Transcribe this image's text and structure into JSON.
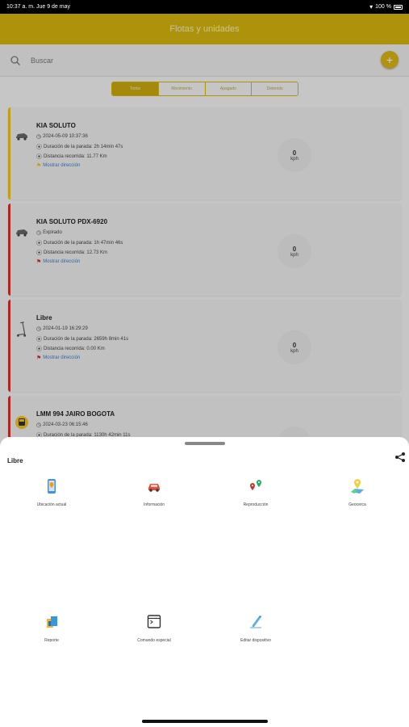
{
  "status_bar": {
    "time_date": "10:37 a. m.  Jue 9 de may",
    "battery": "100 %"
  },
  "header": {
    "title": "Flotas y unidades"
  },
  "search": {
    "placeholder": "Buscar",
    "add_label": "+"
  },
  "tabs": [
    {
      "label": "Todos",
      "active": true
    },
    {
      "label": "Movimiento",
      "active": false
    },
    {
      "label": "Apagado",
      "active": false
    },
    {
      "label": "Detenido",
      "active": false
    }
  ],
  "cards": [
    {
      "name": "KIA SOLUTO",
      "status_color": "#e8c31a",
      "vehicle_icon": "car-icon",
      "line1": "2024-05-09 10:37:36",
      "line2": "Duración de la parada: 2h 14min 47s",
      "line3": "Distancia recorrida: 11.77 Km",
      "link": "Mostrar dirección",
      "speed": "0",
      "speed_unit": "kph"
    },
    {
      "name": "KIA SOLUTO PDX-6920",
      "status_color": "#d32f2f",
      "vehicle_icon": "car-icon",
      "line1": "Expirado",
      "line2": "Duración de la parada: 1h 47min 46s",
      "line3": "Distancia recorrida: 12.73 Km",
      "link": "Mostrar dirección",
      "speed": "0",
      "speed_unit": "kph"
    },
    {
      "name": "Libre",
      "status_color": "#d32f2f",
      "vehicle_icon": "scooter-icon",
      "line1": "2024-01-19 16:29:29",
      "line2": "Duración de la parada: 2659h 8min 41s",
      "line3": "Distancia recorrida: 0.00 Km",
      "link": "Mostrar dirección",
      "speed": "0",
      "speed_unit": "kph"
    },
    {
      "name": "LMM 994 JAIRO BOGOTA",
      "status_color": "#d32f2f",
      "vehicle_icon": "bus-icon",
      "line1": "2024-03-23 06:15:46",
      "line2": "Duración de la parada: 1130h 42min 11s",
      "speed": "0"
    }
  ],
  "sheet": {
    "title": "Libre",
    "actions": [
      {
        "label": "Ubicación actual",
        "icon": "phone-location-icon"
      },
      {
        "label": "Información",
        "icon": "red-car-icon"
      },
      {
        "label": "Reproducción",
        "icon": "route-pins-icon"
      },
      {
        "label": "Geocerca",
        "icon": "geofence-map-icon"
      },
      {
        "label": "Reporte",
        "icon": "report-icon"
      },
      {
        "label": "Comando especial",
        "icon": "terminal-icon"
      },
      {
        "label": "Editar dispositivo",
        "icon": "edit-pencil-icon"
      }
    ]
  },
  "colors": {
    "accent": "#d4b40e",
    "alert": "#d32f2f",
    "link": "#3b7bc7"
  }
}
